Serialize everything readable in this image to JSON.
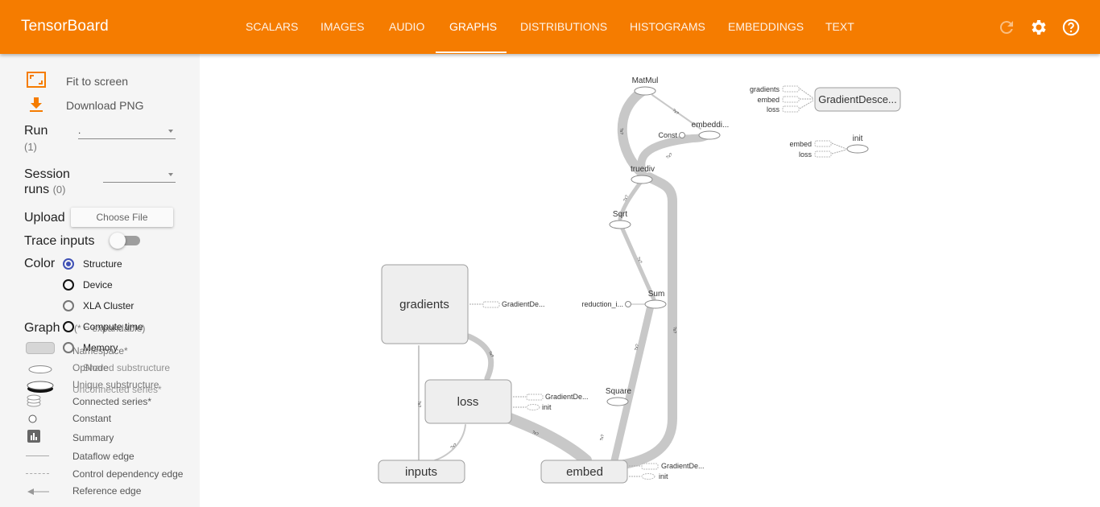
{
  "app": {
    "title": "TensorBoard"
  },
  "tabs": [
    {
      "label": "SCALARS",
      "active": false
    },
    {
      "label": "IMAGES",
      "active": false
    },
    {
      "label": "AUDIO",
      "active": false
    },
    {
      "label": "GRAPHS",
      "active": true
    },
    {
      "label": "DISTRIBUTIONS",
      "active": false
    },
    {
      "label": "HISTOGRAMS",
      "active": false
    },
    {
      "label": "EMBEDDINGS",
      "active": false
    },
    {
      "label": "TEXT",
      "active": false
    }
  ],
  "header_icons": [
    "refresh-icon",
    "settings-gear-icon",
    "help-icon"
  ],
  "colors": {
    "header": "#f57c00",
    "accent": "#3f51b5",
    "sidebar": "#f5f5f5",
    "node_fill": "#eeeeee",
    "edge": "#c8c8c8"
  },
  "sidebar": {
    "fit_to_screen": "Fit to screen",
    "download_png": "Download PNG",
    "run": {
      "label": "Run",
      "count": "(1)",
      "value": "."
    },
    "session_runs": {
      "label_line1": "Session",
      "label_line2": "runs",
      "count": "(0)",
      "value": ""
    },
    "upload": {
      "label": "Upload",
      "button": "Choose File"
    },
    "trace_inputs": {
      "label": "Trace inputs",
      "on": false
    },
    "color": {
      "label": "Color",
      "options": [
        {
          "label": "Structure",
          "checked": true
        },
        {
          "label": "Device",
          "checked": false
        },
        {
          "label": "XLA Cluster",
          "checked": false
        },
        {
          "label": "Compute time",
          "checked": false
        },
        {
          "label": "Memory",
          "checked": false
        }
      ]
    },
    "graph_legend": {
      "label": "Graph",
      "expandability": "(* = expandable)",
      "items": [
        "Namespace*",
        "OpNode",
        "Unique substructure",
        "Unconnected series*",
        "Connected series*",
        "Constant",
        "Summary",
        "Dataflow edge",
        "Control dependency edge",
        "Reference edge"
      ],
      "overlaps": [
        "Shared substructure"
      ]
    }
  },
  "graph": {
    "namespaces": [
      {
        "label": "gradients"
      },
      {
        "label": "loss"
      },
      {
        "label": "inputs"
      },
      {
        "label": "embed"
      },
      {
        "label": "GradientDesce..."
      }
    ],
    "op_nodes": [
      "MatMul",
      "embeddi...",
      "truediv",
      "Sqrt",
      "Sum",
      "Square",
      "init"
    ],
    "constants": [
      "Const",
      "reduction_i..."
    ],
    "aux_labels": {
      "gradients_to": "GradientDe...",
      "loss_to_1": "GradientDe...",
      "loss_to_2": "init",
      "embed_to_1": "GradientDe...",
      "embed_to_2": "init",
      "gd_from": [
        "gradients",
        "embed",
        "loss"
      ],
      "init_from": [
        "embed",
        "loss"
      ]
    },
    "edge_labels": [
      "?x?",
      "?x?",
      "?x?",
      "?x?",
      "?x?",
      "?x?",
      "?x?",
      "?x?",
      "?x?",
      "?x?",
      "?x?",
      "?x?"
    ]
  }
}
